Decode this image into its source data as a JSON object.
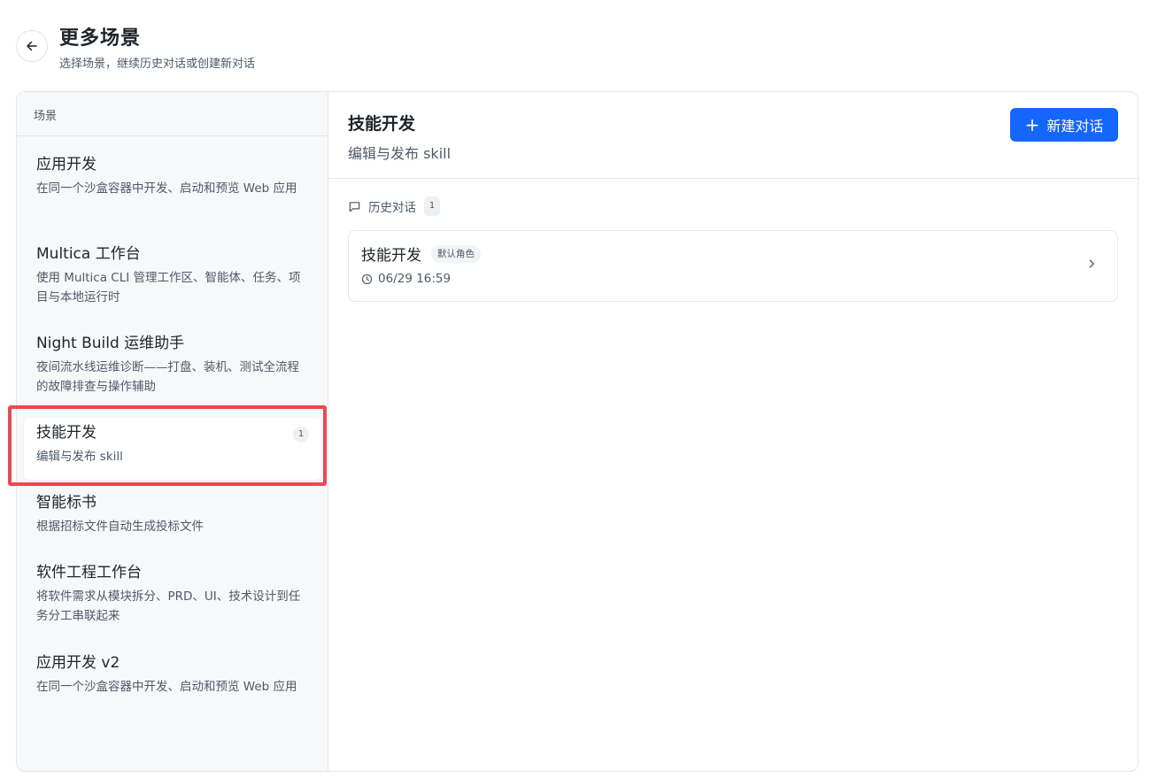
{
  "header": {
    "title": "更多场景",
    "subtitle": "选择场景，继续历史对话或创建新对话",
    "back_icon": "arrow-left-icon"
  },
  "sidebar": {
    "heading": "场景",
    "items": [
      {
        "title": "应用开发",
        "desc": "在同一个沙盒容器中开发、启动和预览 Web 应用",
        "active": false
      },
      {
        "title": "Multica 工作台",
        "desc": "使用 Multica CLI 管理工作区、智能体、任务、项目与本地运行时",
        "active": false
      },
      {
        "title": "Night Build 运维助手",
        "desc": "夜间流水线运维诊断——打盘、装机、测试全流程的故障排查与操作辅助",
        "active": false
      },
      {
        "title": "技能开发",
        "desc": "编辑与发布 skill",
        "active": true,
        "badge": "1"
      },
      {
        "title": "智能标书",
        "desc": "根据招标文件自动生成投标文件",
        "active": false
      },
      {
        "title": "软件工程工作台",
        "desc": "将软件需求从模块拆分、PRD、UI、技术设计到任务分工串联起来",
        "active": false
      },
      {
        "title": "应用开发 v2",
        "desc": "在同一个沙盒容器中开发、启动和预览 Web 应用",
        "active": false
      }
    ]
  },
  "main": {
    "title": "技能开发",
    "subtitle": "编辑与发布 skill",
    "new_chat_label": "新建对话",
    "history": {
      "label": "历史对话",
      "count": "1",
      "conversations": [
        {
          "title": "技能开发",
          "role": "默认角色",
          "time": "06/29 16:59"
        }
      ]
    }
  },
  "colors": {
    "accent": "#1565ff",
    "highlight": "#e84a4e",
    "sidebar_bg": "#f7f8fa"
  }
}
